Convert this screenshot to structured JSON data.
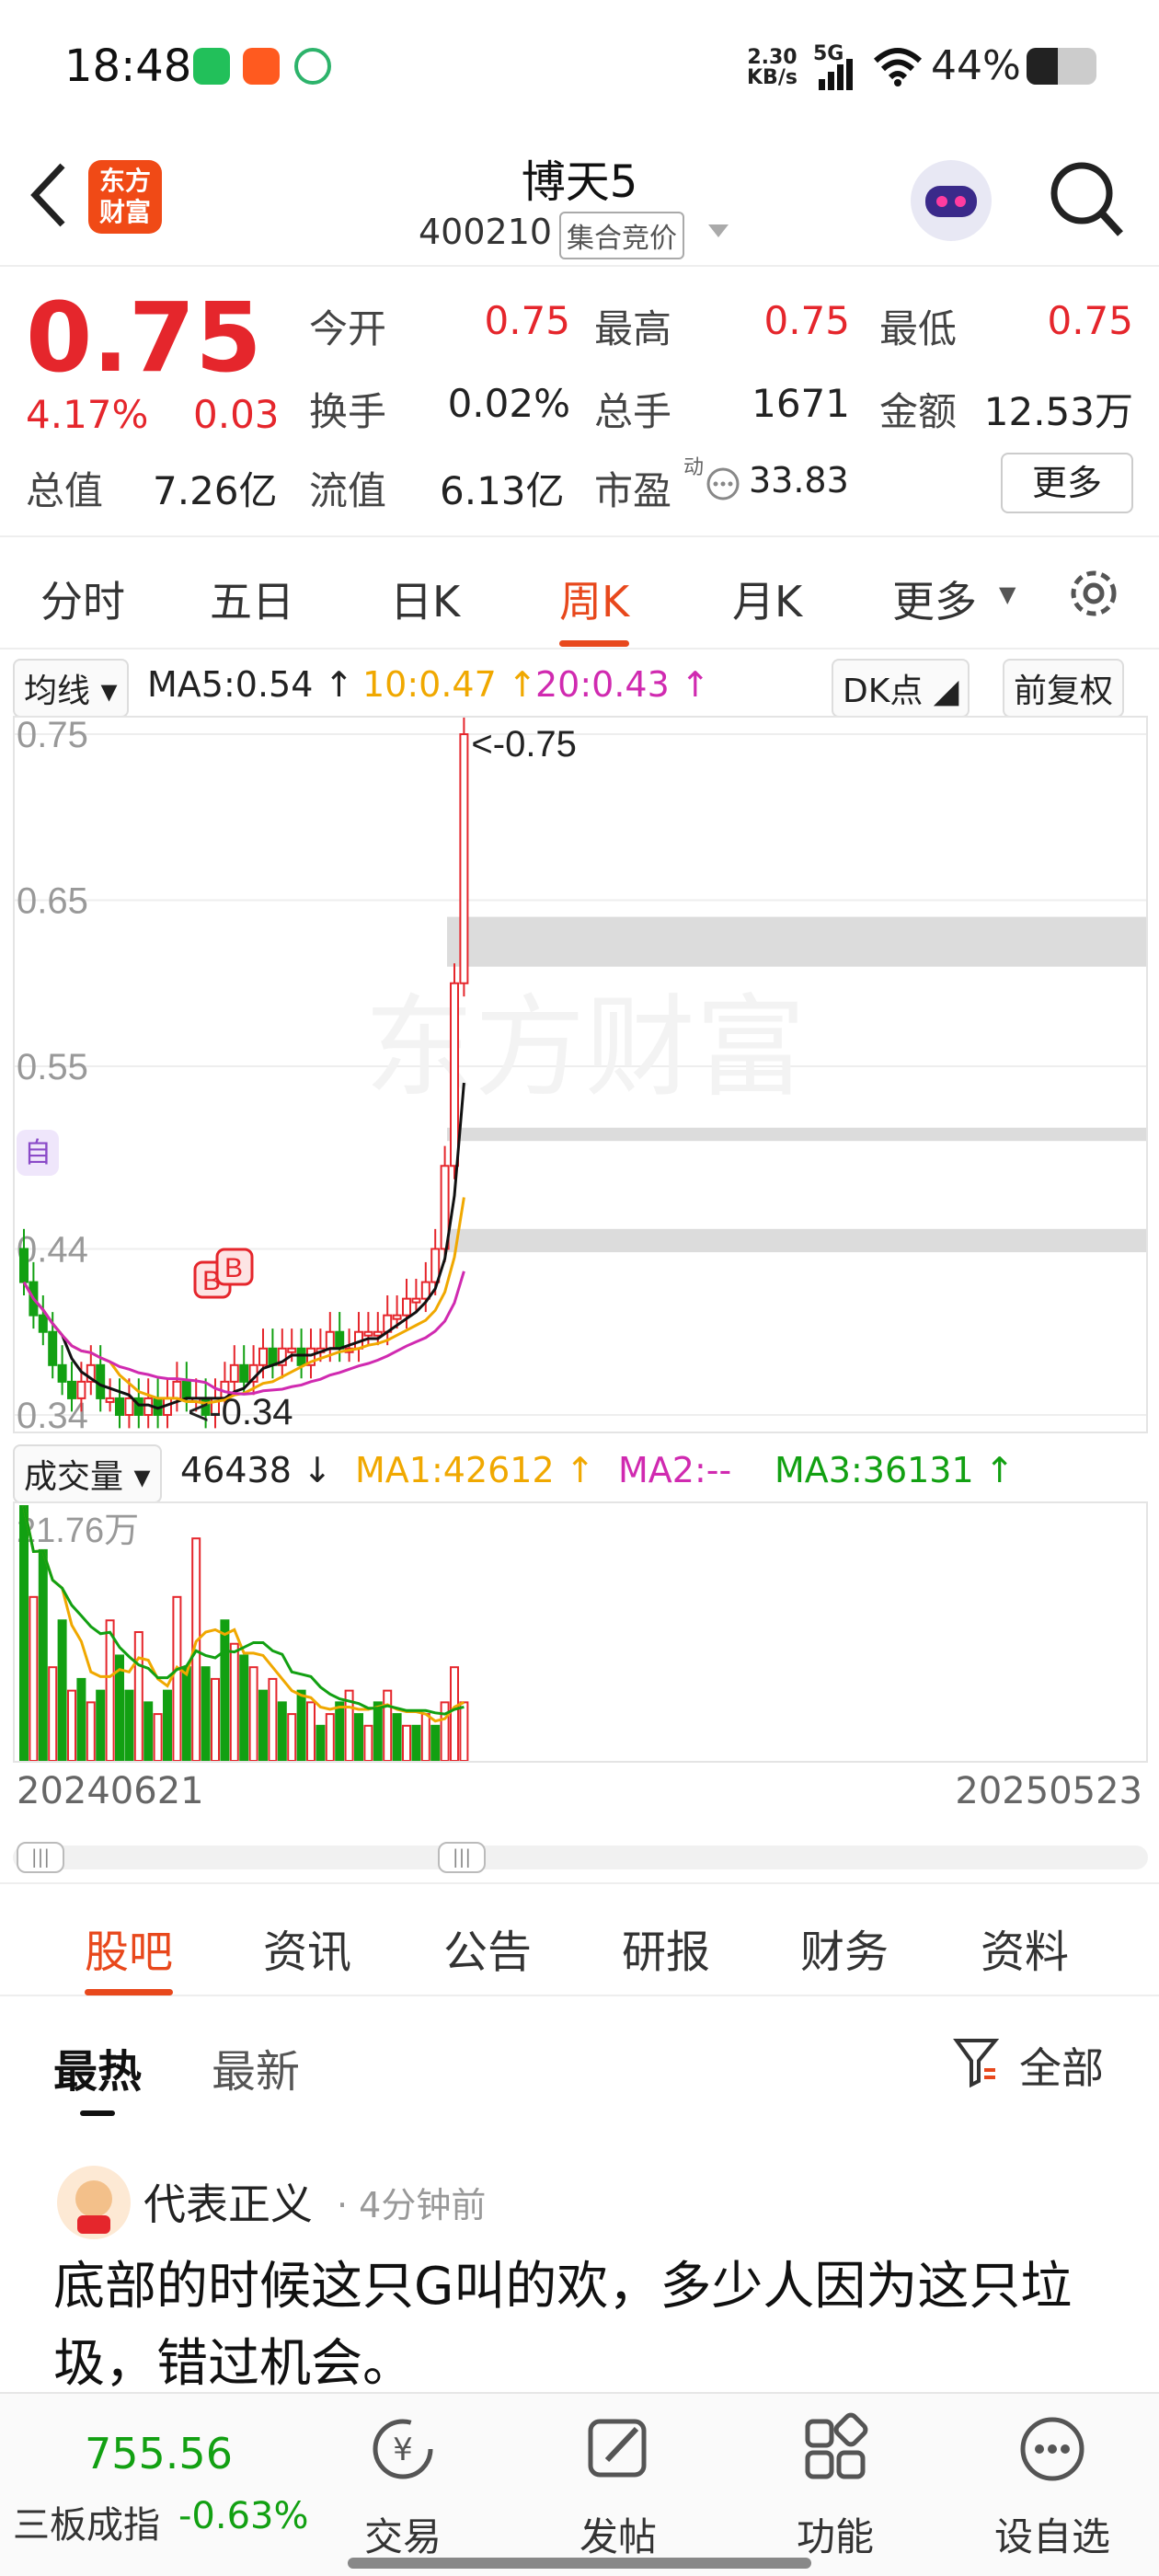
{
  "status_bar": {
    "time": "18:48",
    "net_speed": "2.30",
    "net_unit": "KB/s",
    "signal": "5G",
    "battery": "44%"
  },
  "header": {
    "logo_text_1": "东方",
    "logo_text_2": "财富",
    "title": "博天5",
    "code": "400210",
    "auction_badge": "集合竞价"
  },
  "quote": {
    "price": "0.75",
    "change_pct": "4.17%",
    "change_amt": "0.03",
    "fields": [
      {
        "label": "今开",
        "value": "0.75",
        "red": true
      },
      {
        "label": "最高",
        "value": "0.75",
        "red": true
      },
      {
        "label": "最低",
        "value": "0.75",
        "red": true
      },
      {
        "label": "换手",
        "value": "0.02%",
        "red": false
      },
      {
        "label": "总手",
        "value": "1671",
        "red": false
      },
      {
        "label": "金额",
        "value": "12.53万",
        "red": false
      },
      {
        "label": "总值",
        "value": "7.26亿",
        "red": false
      },
      {
        "label": "流值",
        "value": "6.13亿",
        "red": false
      },
      {
        "label": "市盈",
        "value": "33.83",
        "red": false
      }
    ],
    "pe_sup": "动",
    "more_label": "更多"
  },
  "kline_tabs": [
    "分时",
    "五日",
    "日K",
    "周K",
    "月K",
    "更多"
  ],
  "kline_active": "周K",
  "ma_bar": {
    "indicator": "均线",
    "ma5": "MA5:0.54",
    "ma10": "10:0.47",
    "ma20": "20:0.43",
    "dk": "DK点",
    "adjust": "前复权"
  },
  "chart_data": {
    "type": "candlestick",
    "y_ticks": [
      "0.75",
      "0.65",
      "0.55",
      "0.44",
      "0.34"
    ],
    "ylim": [
      0.33,
      0.76
    ],
    "high_label": "<-0.75",
    "low_label": "<-0.34",
    "self_marker": "自",
    "bs_marker": "B",
    "watermark": "东方财富",
    "x_start": "20240621",
    "x_end": "20250523",
    "closes": [
      0.42,
      0.4,
      0.39,
      0.37,
      0.36,
      0.35,
      0.36,
      0.37,
      0.35,
      0.35,
      0.34,
      0.35,
      0.34,
      0.35,
      0.34,
      0.35,
      0.36,
      0.35,
      0.35,
      0.34,
      0.35,
      0.36,
      0.37,
      0.36,
      0.37,
      0.38,
      0.37,
      0.38,
      0.38,
      0.37,
      0.38,
      0.38,
      0.39,
      0.38,
      0.38,
      0.39,
      0.39,
      0.39,
      0.4,
      0.4,
      0.41,
      0.41,
      0.42,
      0.44,
      0.49,
      0.6,
      0.75
    ],
    "ma_colors": {
      "ma5": "#111111",
      "ma10": "#f0a800",
      "ma20": "#d02ab0"
    }
  },
  "vol_bar": {
    "label": "成交量",
    "value": "46438",
    "ma1": "MA1:42612",
    "ma2": "MA2:--",
    "ma3": "MA3:36131"
  },
  "vol_data": {
    "max_label": "21.76万",
    "values": [
      21.76,
      14,
      18,
      8,
      12,
      6,
      7,
      5,
      6,
      12,
      9,
      6,
      11,
      5,
      4,
      6,
      14,
      8,
      19,
      8,
      7,
      12,
      10,
      9,
      8,
      6,
      7,
      5,
      4,
      6,
      5,
      3,
      4,
      5,
      6,
      4,
      3,
      5,
      6,
      4,
      3,
      3,
      4,
      3,
      5,
      8,
      5
    ],
    "up": [
      false,
      true,
      false,
      true,
      false,
      true,
      false,
      true,
      false,
      true,
      false,
      false,
      true,
      false,
      true,
      false,
      true,
      false,
      true,
      false,
      true,
      false,
      true,
      false,
      true,
      false,
      true,
      false,
      true,
      false,
      true,
      false,
      true,
      false,
      true,
      false,
      true,
      false,
      true,
      false,
      true,
      false,
      true,
      false,
      true,
      true,
      true
    ]
  },
  "sub_tabs": [
    "股吧",
    "资讯",
    "公告",
    "研报",
    "财务",
    "资料"
  ],
  "sub_active": "股吧",
  "feed_tabs": [
    "最热",
    "最新"
  ],
  "feed_active": "最热",
  "filter_label": "全部",
  "post": {
    "author": "代表正义",
    "time": "· 4分钟前",
    "text": "底部的时候这只G叫的欢，多少人因为这只垃圾，错过机会。"
  },
  "bottom": {
    "index_value": "755.56",
    "index_name": "三板成指",
    "index_change": "-0.63%",
    "nav": [
      "交易",
      "发帖",
      "功能",
      "设自选"
    ]
  }
}
